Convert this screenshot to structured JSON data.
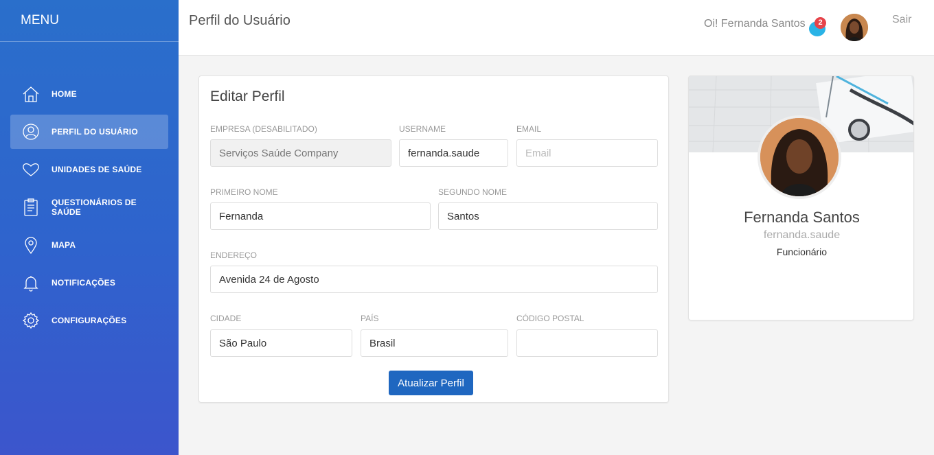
{
  "sidebar": {
    "title": "MENU",
    "items": [
      {
        "label": "HOME",
        "icon": "home-icon",
        "active": false
      },
      {
        "label": "PERFIL DO USUÁRIO",
        "icon": "user-icon",
        "active": true
      },
      {
        "label": "UNIDADES DE SAÚDE",
        "icon": "heart-icon",
        "active": false
      },
      {
        "label": "QUESTIONÁRIOS DE SAÚDE",
        "icon": "clipboard-icon",
        "active": false
      },
      {
        "label": "MAPA",
        "icon": "map-pin-icon",
        "active": false
      },
      {
        "label": "NOTIFICAÇÕES",
        "icon": "bell-icon",
        "active": false
      },
      {
        "label": "CONFIGURAÇÕES",
        "icon": "gear-icon",
        "active": false
      }
    ]
  },
  "header": {
    "page_title": "Perfil do Usuário",
    "greeting": "Oi! Fernanda Santos",
    "notification_count": "2",
    "logout_label": "Sair"
  },
  "form": {
    "title": "Editar Perfil",
    "company": {
      "label": "Empresa (desabilitado)",
      "value": "Serviços Saúde Company"
    },
    "username": {
      "label": "Username",
      "value": "fernanda.saude"
    },
    "email": {
      "label": "Email",
      "value": "",
      "placeholder": "Email"
    },
    "first_name": {
      "label": "Primeiro Nome",
      "value": "Fernanda"
    },
    "last_name": {
      "label": "Segundo Nome",
      "value": "Santos"
    },
    "address": {
      "label": "Endereço",
      "value": "Avenida 24 de Agosto"
    },
    "city": {
      "label": "Cidade",
      "value": "São Paulo"
    },
    "country": {
      "label": "País",
      "value": "Brasil"
    },
    "postal_code": {
      "label": "Código Postal",
      "value": ""
    },
    "submit_label": "Atualizar Perfil"
  },
  "profile": {
    "name": "Fernanda Santos",
    "username": "fernanda.saude",
    "role": "Funcionário"
  },
  "colors": {
    "sidebar_top": "#2a6fcb",
    "sidebar_bottom": "#3c55cc",
    "primary_button": "#1f67c0",
    "badge": "#e6434a",
    "notification_bubble": "#2ab3e6"
  }
}
